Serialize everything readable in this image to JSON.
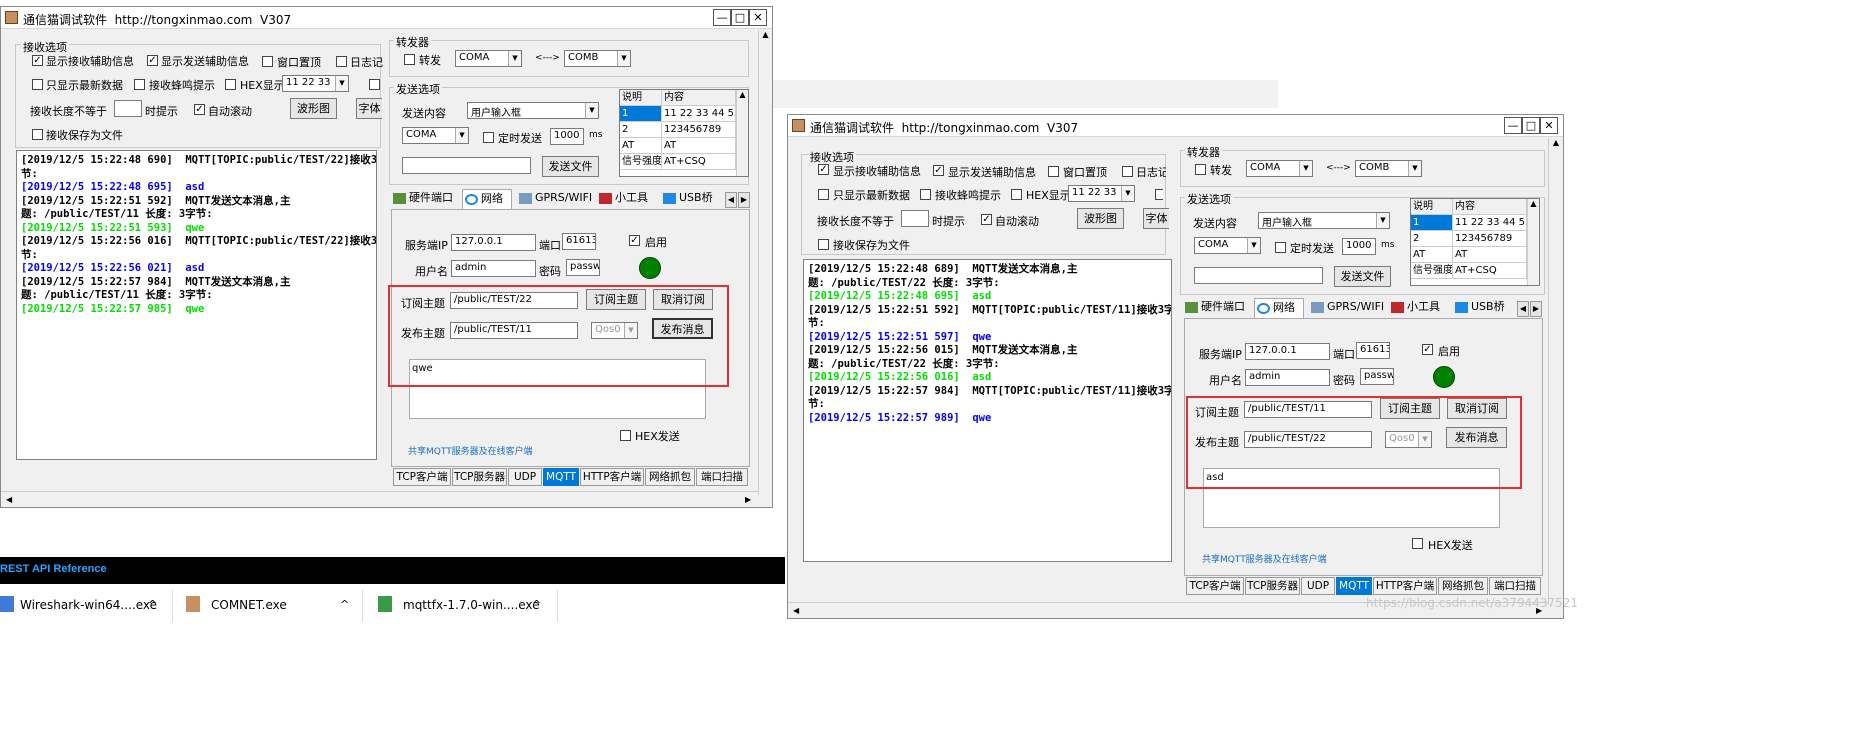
{
  "window_common": {
    "title": "通信猫调试软件",
    "url": "http://tongxinmao.com",
    "version": "V307",
    "min_glyph": "—",
    "max_glyph": "□",
    "close_glyph": "✕",
    "recv_options": "接收选项",
    "show_recv_aux": "显示接收辅助信息",
    "show_send_aux": "显示发送辅助信息",
    "window_top": "窗口置顶",
    "log": "日志记",
    "log_right": "日志记录",
    "only_latest": "只显示最新数据",
    "recv_beep": "接收蜂鸣提示",
    "hex_show": "HEX显示",
    "hex_value": "11 22 33",
    "recv_len_ne": "接收长度不等于",
    "hint_when": "时提示",
    "auto_scroll": "自动滚动",
    "waveform": "波形图",
    "font": "字体",
    "font_short": "字体",
    "save_to_file": "接收保存为文件",
    "forwarder": "转发器",
    "forward": "转发",
    "coma": "COMA",
    "arrow_both": "<--->",
    "comb": "COMB",
    "send_options": "发送选项",
    "send_content": "发送内容",
    "user_input": "用户输入框",
    "timed_send": "定时发送",
    "interval": "1000",
    "ms": "ms",
    "send_file": "发送文件",
    "table_headers": [
      "说明",
      "内容"
    ],
    "table_rows": [
      [
        "1",
        "11 22 33 44 55"
      ],
      [
        "2",
        "123456789"
      ],
      [
        "AT",
        "AT"
      ],
      [
        "信号强度",
        "AT+CSQ"
      ]
    ],
    "panel_tabs": [
      "硬件端口",
      "网络",
      "GPRS/WIFI",
      "小工具",
      "USB桥"
    ],
    "server_ip_label": "服务端IP",
    "server_ip": "127.0.0.1",
    "port_label": "端口",
    "port": "61613",
    "enable": "启用",
    "username_label": "用户名",
    "username": "admin",
    "password_label": "密码",
    "password": "passwo",
    "sub_topic_label": "订阅主题",
    "subscribe_btn": "订阅主题",
    "unsubscribe_btn": "取消订阅",
    "pub_topic_label": "发布主题",
    "qos": "Qos0",
    "publish_btn": "发布消息",
    "hex_send": "HEX发送",
    "share_link": "共享MQTT服务器及在线客户端",
    "bottom_tabs": [
      "TCP客户端",
      "TCP服务器",
      "UDP",
      "MQTT",
      "HTTP客户端",
      "网络抓包",
      "端口扫描"
    ]
  },
  "window_left": {
    "sub_topic": "/public/TEST/22",
    "pub_topic": "/public/TEST/11",
    "message": "qwe",
    "log": [
      {
        "text": "[2019/12/5 15:22:48 690]  MQTT[TOPIC:public/TEST/22]接收3字",
        "color": "black"
      },
      {
        "text": "节:",
        "color": "black"
      },
      {
        "text": "[2019/12/5 15:22:48 695]  asd",
        "color": "blue"
      },
      {
        "text": "[2019/12/5 15:22:51 592]  MQTT发送文本消息,主",
        "color": "black"
      },
      {
        "text": "题: /public/TEST/11 长度: 3字节:",
        "color": "black"
      },
      {
        "text": "[2019/12/5 15:22:51 593]  qwe",
        "color": "green"
      },
      {
        "text": "[2019/12/5 15:22:56 016]  MQTT[TOPIC:public/TEST/22]接收3字",
        "color": "black"
      },
      {
        "text": "节:",
        "color": "black"
      },
      {
        "text": "[2019/12/5 15:22:56 021]  asd",
        "color": "blue"
      },
      {
        "text": "[2019/12/5 15:22:57 984]  MQTT发送文本消息,主",
        "color": "black"
      },
      {
        "text": "题: /public/TEST/11 长度: 3字节:",
        "color": "black"
      },
      {
        "text": "[2019/12/5 15:22:57 985]  qwe",
        "color": "green"
      }
    ]
  },
  "window_right": {
    "sub_topic": "/public/TEST/11",
    "pub_topic": "/public/TEST/22",
    "message": "asd",
    "log": [
      {
        "text": "[2019/12/5 15:22:48 689]  MQTT发送文本消息,主",
        "color": "black"
      },
      {
        "text": "题: /public/TEST/22 长度: 3字节:",
        "color": "black"
      },
      {
        "text": "[2019/12/5 15:22:48 695]  asd",
        "color": "green"
      },
      {
        "text": "[2019/12/5 15:22:51 592]  MQTT[TOPIC:public/TEST/11]接收3字",
        "color": "black"
      },
      {
        "text": "节:",
        "color": "black"
      },
      {
        "text": "[2019/12/5 15:22:51 597]  qwe",
        "color": "blue"
      },
      {
        "text": "[2019/12/5 15:22:56 015]  MQTT发送文本消息,主",
        "color": "black"
      },
      {
        "text": "题: /public/TEST/22 长度: 3字节:",
        "color": "black"
      },
      {
        "text": "[2019/12/5 15:22:56 016]  asd",
        "color": "green"
      },
      {
        "text": "[2019/12/5 15:22:57 984]  MQTT[TOPIC:public/TEST/11]接收3字",
        "color": "black"
      },
      {
        "text": "节:",
        "color": "black"
      },
      {
        "text": "[2019/12/5 15:22:57 989]  qwe",
        "color": "blue"
      }
    ]
  },
  "browser_link": "REST API Reference",
  "downloads": [
    {
      "name": "Wireshark-win64....exe",
      "chevron": "^"
    },
    {
      "name": "COMNET.exe",
      "chevron": "^"
    },
    {
      "name": "mqttfx-1.7.0-win....exe",
      "chevron": "^"
    }
  ],
  "watermark": "https://blog.csdn.net/a3794437521",
  "colors": {
    "log_black": "#000000",
    "log_blue": "#0000ff",
    "log_green": "#00dd00",
    "highlight_box": "#e53030",
    "status_dot": "#008000",
    "selected_tab": "#0078d7"
  }
}
